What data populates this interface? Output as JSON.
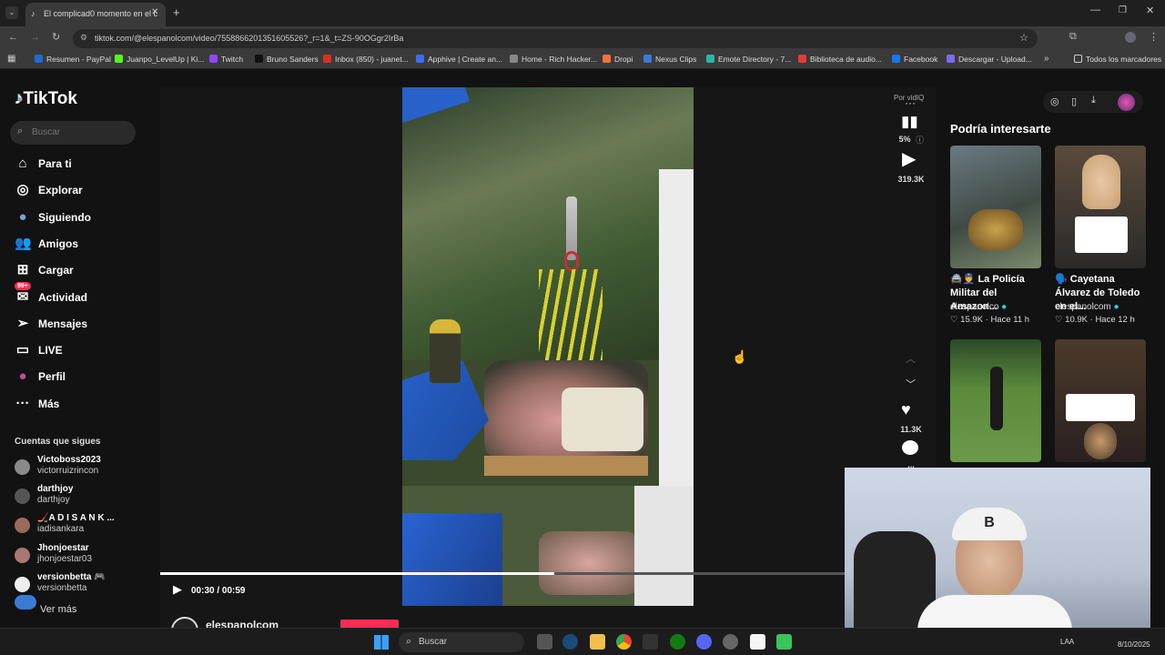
{
  "browser": {
    "tab_title": "El complicad0 momento en el c",
    "url": "tiktok.com/@elespanolcom/video/7558866201351605526?_r=1&_t=ZS-90OGgr2IrBa",
    "bookmarks": [
      {
        "label": "Resumen - PayPal",
        "color": "#1d6bd6"
      },
      {
        "label": "Juanpo_LevelUp | Ki...",
        "color": "#53fc18"
      },
      {
        "label": "Twitch",
        "color": "#9146ff"
      },
      {
        "label": "Bruno Sanders",
        "color": "#111111"
      },
      {
        "label": "Inbox (850) - juanet...",
        "color": "#d93025"
      },
      {
        "label": "Apphive | Create an...",
        "color": "#3b6bff"
      },
      {
        "label": "Home - Rich Hacker...",
        "color": "#888888"
      },
      {
        "label": "Dropi",
        "color": "#f2733a"
      },
      {
        "label": "Nexus Clips",
        "color": "#3a7bd5"
      },
      {
        "label": "Emote Directory - 7...",
        "color": "#29b6a6"
      },
      {
        "label": "Biblioteca de audio...",
        "color": "#e53935"
      },
      {
        "label": "Facebook",
        "color": "#1877f2"
      },
      {
        "label": "Descargar - Upload...",
        "color": "#7a6cf0"
      }
    ],
    "all_bookmarks": "Todos los marcadores"
  },
  "tiktok": {
    "logo": "TikTok",
    "search_placeholder": "Buscar",
    "nav": [
      {
        "label": "Para ti",
        "icon": "home-icon"
      },
      {
        "label": "Explorar",
        "icon": "compass-icon"
      },
      {
        "label": "Siguiendo",
        "icon": "following-icon"
      },
      {
        "label": "Amigos",
        "icon": "friends-icon"
      },
      {
        "label": "Cargar",
        "icon": "upload-icon"
      },
      {
        "label": "Actividad",
        "icon": "activity-icon",
        "badge": "99+"
      },
      {
        "label": "Mensajes",
        "icon": "messages-icon"
      },
      {
        "label": "LIVE",
        "icon": "live-icon"
      },
      {
        "label": "Perfil",
        "icon": "profile-icon"
      },
      {
        "label": "Más",
        "icon": "more-icon"
      }
    ],
    "following_title": "Cuentas que sigues",
    "accounts": [
      {
        "name": "Victoboss2023",
        "handle": "victorruizrincon",
        "color": "#8a8a8a"
      },
      {
        "name": "darthjoy",
        "handle": "darthjoy",
        "color": "#555"
      },
      {
        "name": "🏒A D I S A N K ...",
        "handle": "iadisankara",
        "color": "#9a6a5a"
      },
      {
        "name": "Jhonjoestar",
        "handle": "jhonjoestar03",
        "color": "#a77"
      },
      {
        "name": "versionbetta 🎮",
        "handle": "versionbetta",
        "color": "#eee"
      }
    ],
    "see_more": "Ver más",
    "player": {
      "time": "00:30 / 00:59",
      "progress": 0.508,
      "author": "elespanolcom"
    },
    "actions": {
      "by": "Por vidIQ",
      "percent": "5%",
      "views": "319.3K",
      "likes": "11.3K",
      "comments": "..."
    },
    "suggest_title": "Podría interesarte",
    "cards": [
      {
        "title": "🚔👮 La Policía Militar del Amazon...",
        "user": "elespanolco",
        "likes": "15.9K",
        "time": "Hace 11 h"
      },
      {
        "title": "🗣️ Cayetana Álvarez de Toledo en el...",
        "user": "elespanolcom",
        "likes": "10.9K",
        "time": "Hace 12 h"
      }
    ]
  },
  "taskbar": {
    "search": "Buscar",
    "lang": "LAA",
    "date": "8/10/2025"
  }
}
